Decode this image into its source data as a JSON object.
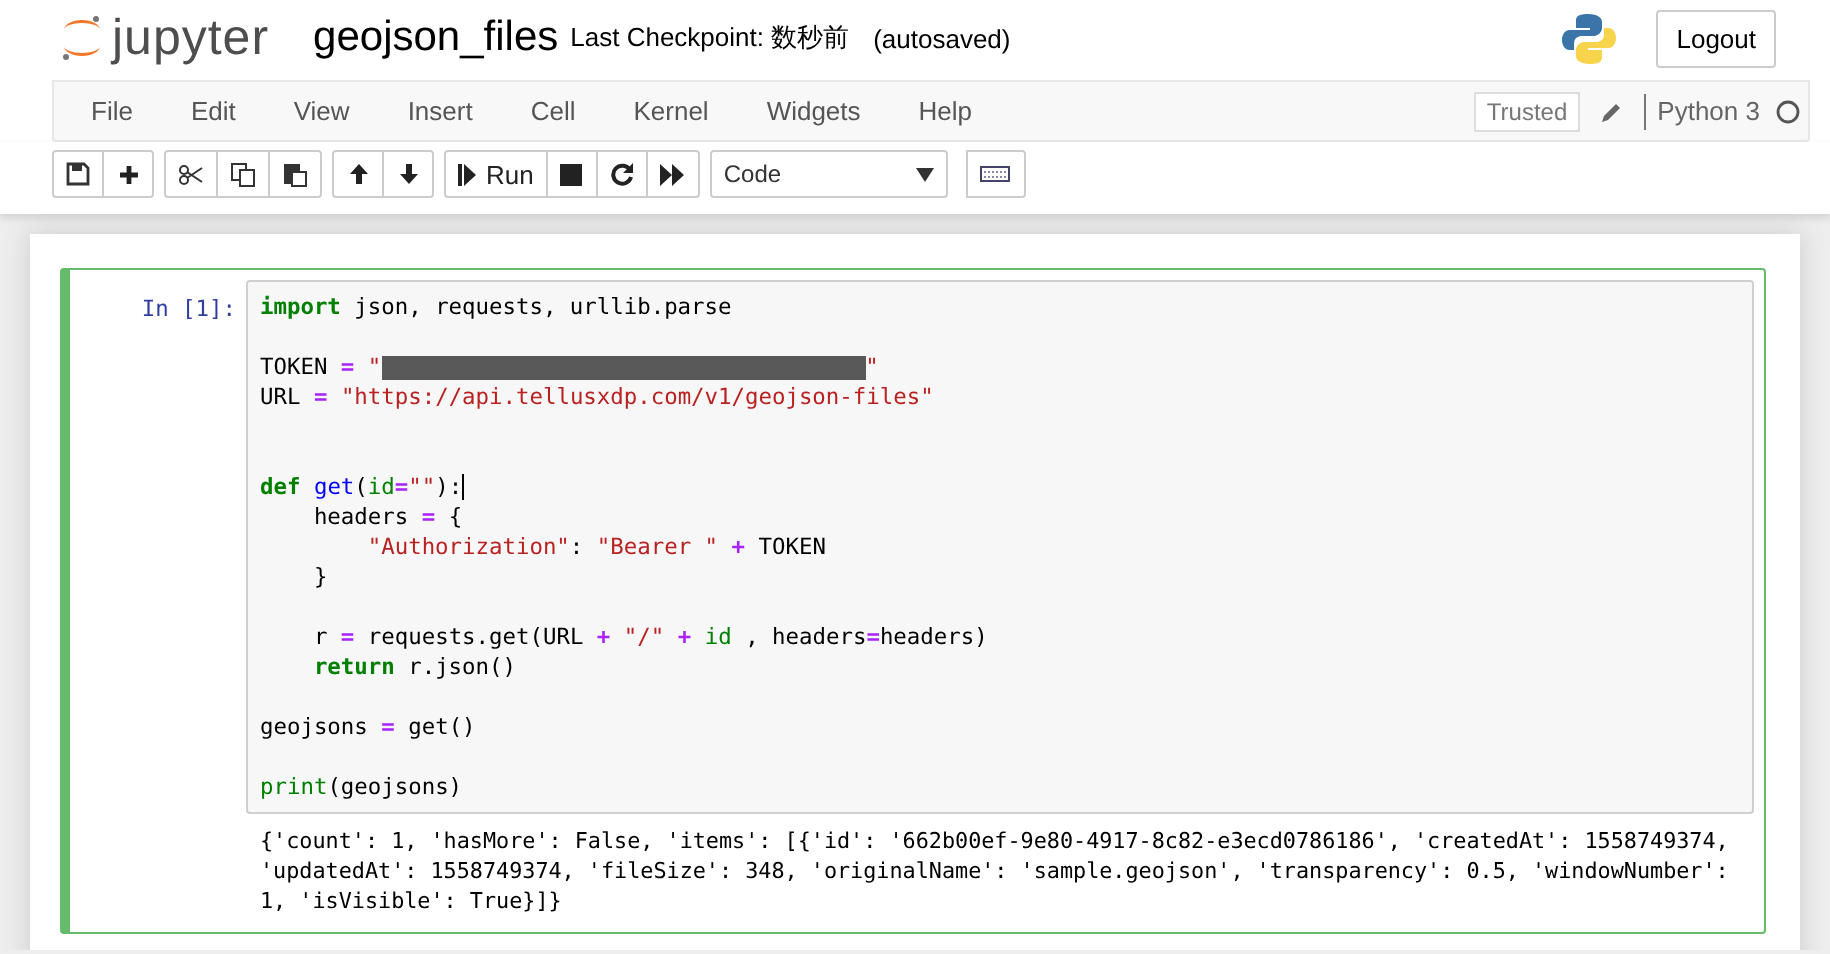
{
  "header": {
    "logo_text": "jupyter",
    "notebook_name": "geojson_files",
    "checkpoint": "Last Checkpoint: 数秒前",
    "autosave": "(autosaved)",
    "logout": "Logout"
  },
  "menu": {
    "items": [
      "File",
      "Edit",
      "View",
      "Insert",
      "Cell",
      "Kernel",
      "Widgets",
      "Help"
    ],
    "trusted": "Trusted",
    "kernel": "Python 3"
  },
  "toolbar": {
    "groups": [
      [
        {
          "kind": "save"
        },
        {
          "kind": "add"
        }
      ],
      [
        {
          "kind": "cut"
        },
        {
          "kind": "copy"
        },
        {
          "kind": "paste"
        }
      ],
      [
        {
          "kind": "up"
        },
        {
          "kind": "down"
        }
      ],
      [
        {
          "kind": "run",
          "label": "Run"
        },
        {
          "kind": "stop"
        },
        {
          "kind": "restart"
        },
        {
          "kind": "fastforward"
        }
      ]
    ],
    "cell_type": "Code"
  },
  "cell": {
    "prompt": "In [1]:",
    "code": [
      {
        "kind": "code",
        "tokens": [
          {
            "kind": "kw",
            "text": "import"
          },
          {
            "kind": "plain",
            "text": " json, requests, urllib.parse"
          }
        ]
      },
      {
        "kind": "blank"
      },
      {
        "kind": "code",
        "tokens": [
          {
            "kind": "plain",
            "text": "TOKEN "
          },
          {
            "kind": "op",
            "text": "="
          },
          {
            "kind": "str",
            "text": " \""
          },
          {
            "kind": "redacted"
          },
          {
            "kind": "str",
            "text": "\""
          }
        ]
      },
      {
        "kind": "code",
        "tokens": [
          {
            "kind": "plain",
            "text": "URL "
          },
          {
            "kind": "op",
            "text": "="
          },
          {
            "kind": "str",
            "text": " \"https://api.tellusxdp.com/v1/geojson-files\""
          }
        ]
      },
      {
        "kind": "blank"
      },
      {
        "kind": "blank"
      },
      {
        "kind": "code",
        "tokens": [
          {
            "kind": "kw",
            "text": "def"
          },
          {
            "kind": "fn",
            "text": " get"
          },
          {
            "kind": "plain",
            "text": "("
          },
          {
            "kind": "builtin",
            "text": "id"
          },
          {
            "kind": "op",
            "text": "="
          },
          {
            "kind": "str",
            "text": "\"\""
          },
          {
            "kind": "plain",
            "text": "):"
          },
          {
            "kind": "cursor"
          }
        ]
      },
      {
        "kind": "code",
        "tokens": [
          {
            "kind": "plain",
            "text": "    headers "
          },
          {
            "kind": "op",
            "text": "="
          },
          {
            "kind": "plain",
            "text": " {"
          }
        ]
      },
      {
        "kind": "code",
        "tokens": [
          {
            "kind": "str",
            "text": "        \"Authorization\""
          },
          {
            "kind": "plain",
            "text": ": "
          },
          {
            "kind": "str",
            "text": "\"Bearer \" "
          },
          {
            "kind": "op",
            "text": "+"
          },
          {
            "kind": "plain",
            "text": " TOKEN"
          }
        ]
      },
      {
        "kind": "code",
        "tokens": [
          {
            "kind": "plain",
            "text": "    }"
          }
        ]
      },
      {
        "kind": "blank"
      },
      {
        "kind": "code",
        "tokens": [
          {
            "kind": "plain",
            "text": "    r "
          },
          {
            "kind": "op",
            "text": "="
          },
          {
            "kind": "plain",
            "text": " requests.get(URL "
          },
          {
            "kind": "op",
            "text": "+"
          },
          {
            "kind": "str",
            "text": " \"/\" "
          },
          {
            "kind": "op",
            "text": "+"
          },
          {
            "kind": "builtin",
            "text": " id"
          },
          {
            "kind": "plain",
            "text": " , headers"
          },
          {
            "kind": "op",
            "text": "="
          },
          {
            "kind": "plain",
            "text": "headers)"
          }
        ]
      },
      {
        "kind": "code",
        "tokens": [
          {
            "kind": "kw",
            "text": "    return"
          },
          {
            "kind": "plain",
            "text": " r.json()"
          }
        ]
      },
      {
        "kind": "blank"
      },
      {
        "kind": "code",
        "tokens": [
          {
            "kind": "plain",
            "text": "geojsons "
          },
          {
            "kind": "op",
            "text": "="
          },
          {
            "kind": "plain",
            "text": " get()"
          }
        ]
      },
      {
        "kind": "blank"
      },
      {
        "kind": "code",
        "tokens": [
          {
            "kind": "builtin",
            "text": "print"
          },
          {
            "kind": "plain",
            "text": "(geojsons)"
          }
        ]
      }
    ],
    "output": [
      "{'count': 1, 'hasMore': False, 'items': [{'id': '662b00ef-9e80-4917-8c82-e3ecd0786186', 'createdAt': 1558749374,",
      "'updatedAt': 1558749374, 'fileSize': 348, 'originalName': 'sample.geojson', 'transparency': 0.5, 'windowNumber':",
      "1, 'isVisible': True}]}"
    ]
  }
}
